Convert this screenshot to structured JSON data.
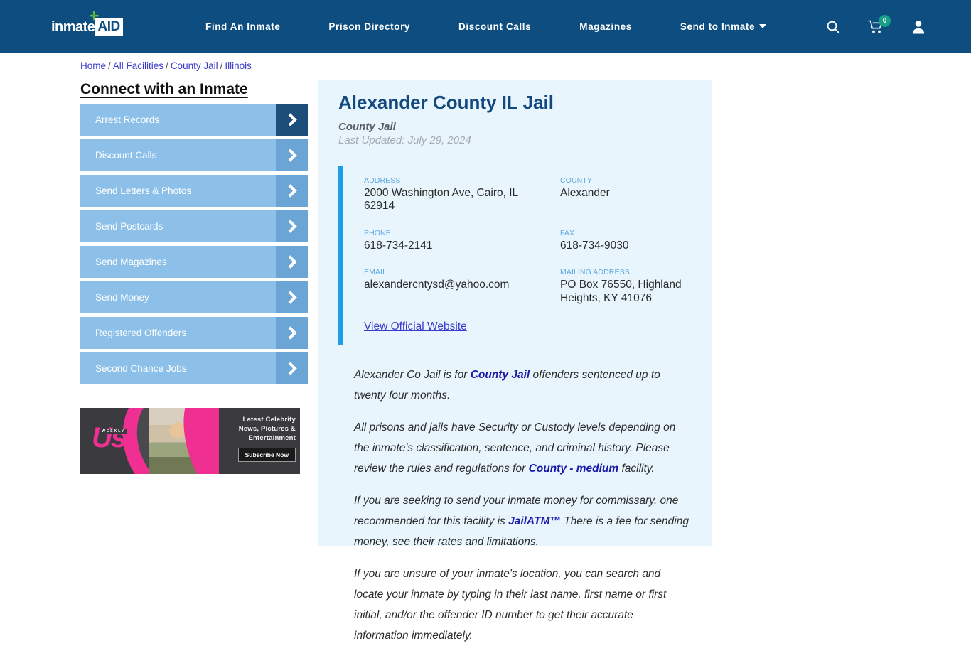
{
  "header": {
    "logo": {
      "word": "inmate",
      "badge": "AID",
      "cross_icon": "plus-cross-icon"
    },
    "nav": [
      {
        "label": "Find An Inmate",
        "has_caret": false
      },
      {
        "label": "Prison Directory",
        "has_caret": false
      },
      {
        "label": "Discount Calls",
        "has_caret": false
      },
      {
        "label": "Magazines",
        "has_caret": false
      },
      {
        "label": "Send to Inmate",
        "has_caret": true
      }
    ],
    "icons": {
      "search": "search-icon",
      "cart": "shopping-cart-icon",
      "cart_count": "0",
      "account": "user-account-icon"
    },
    "bg_color": "#0d4d80"
  },
  "breadcrumb": {
    "items": [
      "Home",
      "All Facilities",
      "County Jail",
      "Illinois"
    ],
    "separator": "/"
  },
  "sidebar": {
    "title": "Connect with an Inmate",
    "items": [
      {
        "label": "Arrest Records",
        "active": true
      },
      {
        "label": "Discount Calls",
        "active": false
      },
      {
        "label": "Send Letters & Photos",
        "active": false
      },
      {
        "label": "Send Postcards",
        "active": false
      },
      {
        "label": "Send Magazines",
        "active": false
      },
      {
        "label": "Send Money",
        "active": false
      },
      {
        "label": "Registered Offenders",
        "active": false
      },
      {
        "label": "Second Chance Jobs",
        "active": false
      }
    ],
    "ad": {
      "brand": "Us",
      "brand_sub": "WEEKLY",
      "headline_line1": "Latest Celebrity",
      "headline_line2": "News, Pictures &",
      "headline_line3": "Entertainment",
      "cta": "Subscribe Now"
    }
  },
  "facility": {
    "name": "Alexander County IL Jail",
    "type": "County Jail",
    "last_updated": "Last Updated: July 29, 2024",
    "fields": [
      {
        "label": "ADDRESS",
        "value": "2000 Washington Ave, Cairo, IL 62914"
      },
      {
        "label": "COUNTY",
        "value": "Alexander"
      },
      {
        "label": "PHONE",
        "value": "618-734-2141"
      },
      {
        "label": "FAX",
        "value": "618-734-9030"
      },
      {
        "label": "EMAIL",
        "value": "alexandercntysd@yahoo.com"
      },
      {
        "label": "MAILING ADDRESS",
        "value": "PO Box 76550, Highland Heights, KY 41076"
      }
    ],
    "website_link": "View Official Website",
    "accent_color": "#1f9dea"
  },
  "content": {
    "paragraphs": [
      {
        "parts": [
          {
            "t": "Alexander Co Jail is for ",
            "b": false
          },
          {
            "t": "County Jail",
            "b": true
          },
          {
            "t": " offenders sentenced up to twenty four months.",
            "b": false
          }
        ]
      },
      {
        "parts": [
          {
            "t": "All prisons and jails have Security or Custody levels depending on the inmate's classification, sentence, and criminal history. Please review the rules and regulations for ",
            "b": false
          },
          {
            "t": "County - medium",
            "b": true
          },
          {
            "t": " facility.",
            "b": false
          }
        ]
      },
      {
        "parts": [
          {
            "t": "If you are seeking to send your inmate money for commissary, one recommended for this facility is ",
            "b": false
          },
          {
            "t": "JailATM™",
            "b": true
          },
          {
            "t": " There is a fee for sending money, see their rates and limitations.",
            "b": false
          }
        ]
      },
      {
        "parts": [
          {
            "t": "If you are unsure of your inmate's location, you can search and locate your inmate by typing in their last name, first name or first initial, and/or the offender ID number to get their accurate information immediately.",
            "b": false
          }
        ]
      }
    ]
  }
}
